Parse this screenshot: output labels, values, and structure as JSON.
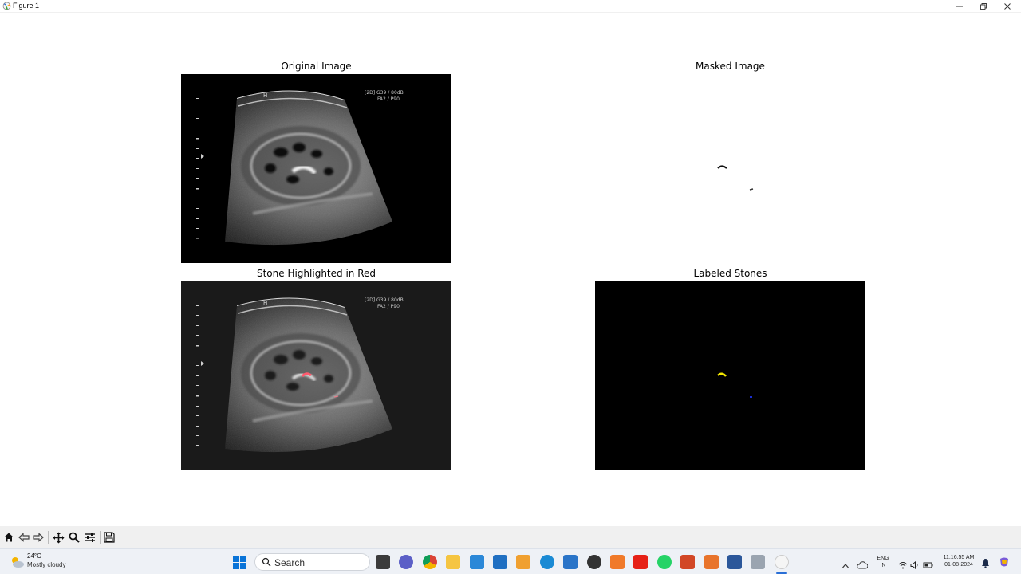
{
  "window": {
    "title": "Figure 1",
    "controls": [
      "minimize",
      "restore",
      "close"
    ]
  },
  "figure": {
    "panels": [
      {
        "title": "Original Image",
        "content": "kidney ultrasound grayscale",
        "overlay_text": [
          "[2D] G39 / 80dB",
          "FA2 / P90"
        ]
      },
      {
        "title": "Masked Image",
        "content": "white background with small dark stone blobs"
      },
      {
        "title": "Stone Highlighted in Red",
        "content": "kidney ultrasound with red highlighted stone",
        "overlay_text": [
          "[2D] G39 / 80dB",
          "FA2 / P90"
        ]
      },
      {
        "title": "Labeled Stones",
        "content": "black background with yellow and blue labeled stones"
      }
    ]
  },
  "toolbar": {
    "buttons": [
      "home-icon",
      "back-icon",
      "forward-icon",
      "pan-icon",
      "zoom-icon",
      "configure-subplots-icon",
      "save-icon"
    ]
  },
  "taskbar": {
    "weather": {
      "temp": "24°C",
      "condition": "Mostly cloudy"
    },
    "search_placeholder": "Search",
    "apps": [
      "windows-start-icon",
      "file-explorer-icon",
      "chat-icon",
      "chrome-icon",
      "folder-icon",
      "notepad-icon",
      "vscode-icon",
      "git-icon",
      "edge-icon",
      "store-icon",
      "dell-icon",
      "xampp-icon",
      "youtube-icon",
      "whatsapp-icon",
      "powerpoint-icon",
      "matlab-icon",
      "word-icon",
      "recorder-icon",
      "matplotlib-icon"
    ],
    "tray": {
      "lang_top": "ENG",
      "lang_bottom": "IN",
      "time": "11:16:55 AM",
      "date": "01-08-2024"
    }
  },
  "colors": {
    "highlight_red": "#ff5a6e",
    "label_yellow": "#f2e600",
    "label_blue": "#1a2fd0",
    "taskbar_bg": "#eef1f6",
    "toolbar_bg": "#f0f0f0"
  }
}
